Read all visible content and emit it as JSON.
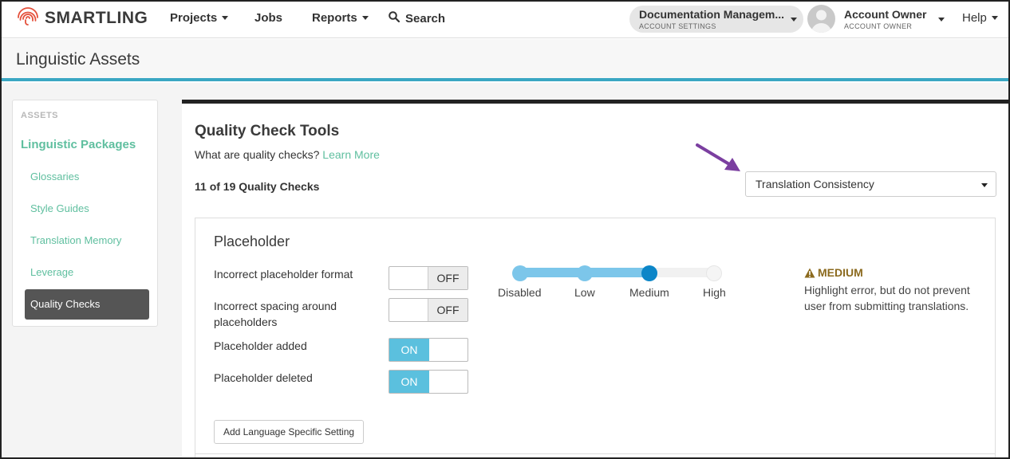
{
  "nav": {
    "logo_text": "SMARTLING",
    "projects": "Projects",
    "jobs": "Jobs",
    "reports": "Reports",
    "search": "Search",
    "account_name": "Documentation Managem...",
    "account_sub": "ACCOUNT SETTINGS",
    "user_name": "Account Owner",
    "user_role": "ACCOUNT OWNER",
    "help": "Help"
  },
  "page": {
    "title": "Linguistic Assets"
  },
  "sidebar": {
    "section": "ASSETS",
    "group": "Linguistic Packages",
    "items": [
      "Glossaries",
      "Style Guides",
      "Translation Memory",
      "Leverage",
      "Quality Checks"
    ],
    "active_index": 4
  },
  "main": {
    "title": "Quality Check Tools",
    "subtitle": "What are quality checks?",
    "learn_more": "Learn More",
    "count": "11 of 19 Quality Checks",
    "dropdown_value": "Translation Consistency"
  },
  "card": {
    "title": "Placeholder",
    "checks": [
      {
        "label": "Incorrect placeholder format",
        "state": "OFF"
      },
      {
        "label": "Incorrect spacing around placeholders",
        "state": "OFF"
      },
      {
        "label": "Placeholder added",
        "state": "ON"
      },
      {
        "label": "Placeholder deleted",
        "state": "ON"
      }
    ],
    "severity_levels": [
      "Disabled",
      "Low",
      "Medium",
      "High"
    ],
    "severity_selected_index": 2,
    "severity_title": "MEDIUM",
    "severity_desc": "Highlight error, but do not prevent user from submitting translations.",
    "add_button": "Add Language Specific Setting"
  },
  "colors": {
    "accent_green": "#5fbf9f",
    "accent_blue": "#3aa7c3",
    "toggle_on": "#5bc0de",
    "slider_fill": "#7cc6ea",
    "slider_selected": "#0c86c8",
    "severity": "#8b6a1e",
    "arrow": "#7b3fa0"
  }
}
